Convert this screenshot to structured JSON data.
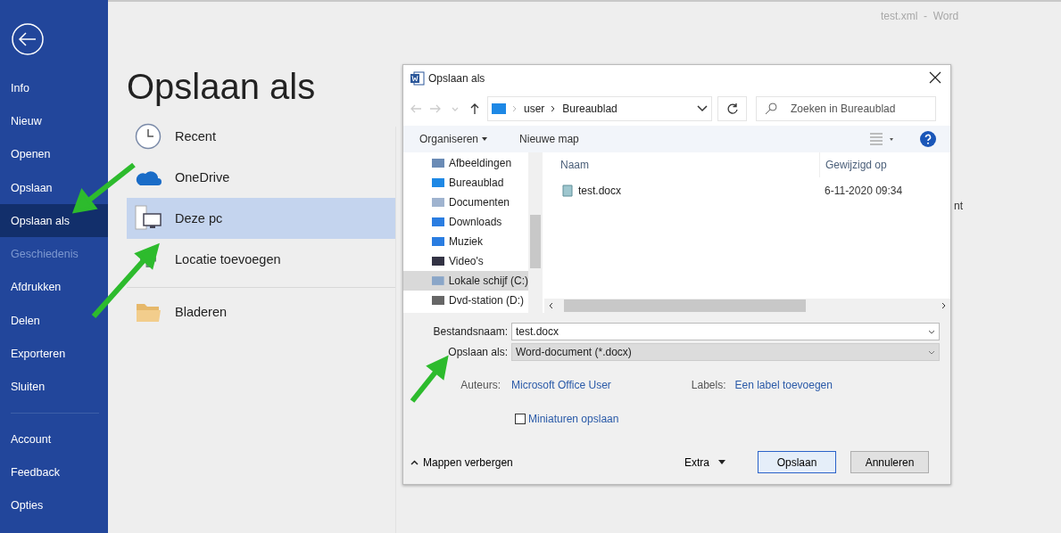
{
  "app_title": "test.xml  -  Word",
  "sidebar": {
    "items": [
      {
        "label": "Info",
        "selected": false,
        "disabled": false
      },
      {
        "label": "Nieuw",
        "selected": false,
        "disabled": false
      },
      {
        "label": "Openen",
        "selected": false,
        "disabled": false
      },
      {
        "label": "Opslaan",
        "selected": false,
        "disabled": false
      },
      {
        "label": "Opslaan als",
        "selected": true,
        "disabled": false
      },
      {
        "label": "Geschiedenis",
        "selected": false,
        "disabled": true
      },
      {
        "label": "Afdrukken",
        "selected": false,
        "disabled": false
      },
      {
        "label": "Delen",
        "selected": false,
        "disabled": false
      },
      {
        "label": "Exporteren",
        "selected": false,
        "disabled": false
      },
      {
        "label": "Sluiten",
        "selected": false,
        "disabled": false
      }
    ],
    "footer_items": [
      {
        "label": "Account",
        "selected": false
      },
      {
        "label": "Feedback",
        "selected": false
      },
      {
        "label": "Opties",
        "selected": false
      }
    ]
  },
  "page": {
    "heading": "Opslaan als",
    "locations": [
      {
        "label": "Recent",
        "selected": false
      },
      {
        "label": "OneDrive",
        "selected": false
      },
      {
        "label": "Deze pc",
        "selected": true
      },
      {
        "label": "Locatie toevoegen",
        "selected": false
      },
      {
        "label": "Bladeren",
        "selected": false
      }
    ],
    "background_fragment": "nt"
  },
  "dialog": {
    "title": "Opslaan als",
    "address": {
      "path": [
        "user",
        "Bureaublad"
      ]
    },
    "search": {
      "placeholder": "Zoeken in Bureaublad"
    },
    "toolbar": {
      "organize": "Organiseren",
      "new_folder": "Nieuwe map"
    },
    "nav_items": [
      {
        "label": "Afbeeldingen",
        "selected": false
      },
      {
        "label": "Bureaublad",
        "selected": false
      },
      {
        "label": "Documenten",
        "selected": false
      },
      {
        "label": "Downloads",
        "selected": false
      },
      {
        "label": "Muziek",
        "selected": false
      },
      {
        "label": "Video's",
        "selected": false
      },
      {
        "label": "Lokale schijf (C:)",
        "selected": true
      },
      {
        "label": "Dvd-station (D:)",
        "selected": false
      }
    ],
    "file_list": {
      "columns": [
        "Naam",
        "Gewijzigd op"
      ],
      "rows": [
        {
          "name": "test.docx",
          "modified": "6-11-2020 09:34"
        }
      ]
    },
    "form": {
      "filename_label": "Bestandsnaam:",
      "filename": "test.docx",
      "type_label": "Opslaan als:",
      "type": "Word-document (*.docx)",
      "authors_label": "Auteurs:",
      "authors": "Microsoft Office User",
      "tags_label": "Labels:",
      "tags": "Een label toevoegen",
      "thumbnail": {
        "label": "Miniaturen opslaan",
        "checked": false
      }
    },
    "footer": {
      "hide_folders": "Mappen verbergen",
      "tools": "Extra",
      "save": "Opslaan",
      "cancel": "Annuleren"
    }
  }
}
